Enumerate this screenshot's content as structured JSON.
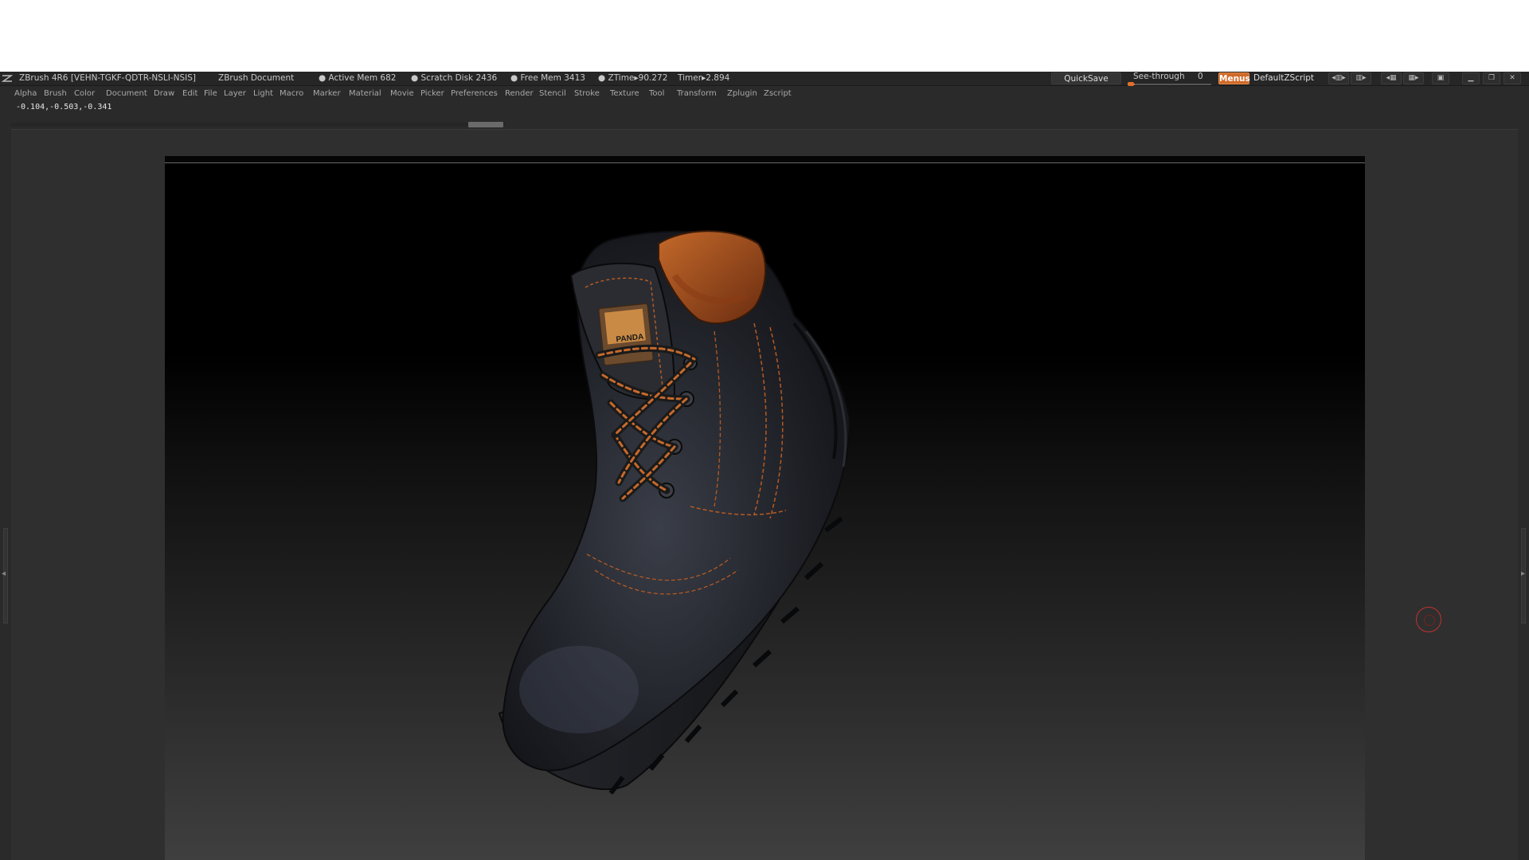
{
  "titlebar": {
    "app_title": "ZBrush 4R6 [VEHN-TGKF-QDTR-NSLI-NSIS]",
    "document_title": "ZBrush Document",
    "active_mem": "● Active Mem 682",
    "scratch_disk": "● Scratch Disk 2436",
    "free_mem": "● Free Mem 3413",
    "ztime": "● ZTime▸90.272",
    "timer": "Timer▸2.894",
    "quicksave": "QuickSave",
    "see_through_label": "See-through",
    "see_through_value": "0",
    "see_through_level": 0.09,
    "menus": "Menus",
    "default_zscript": "DefaultZScript"
  },
  "menu": {
    "items": [
      "Alpha",
      "Brush",
      "Color",
      "Document",
      "Draw",
      "Edit",
      "File",
      "Layer",
      "Light",
      "Macro",
      "Marker",
      "Material",
      "Movie",
      "Picker",
      "Preferences",
      "Render",
      "Stencil",
      "Stroke",
      "Texture",
      "Tool",
      "Transform",
      "Zplugin",
      "Zscript"
    ]
  },
  "status": {
    "coords": "-0.104,-0.503,-0.341"
  },
  "model": {
    "brand_label": "PANDA",
    "colors": {
      "leather": "#1d1f24",
      "stitch": "#c66a2c",
      "lining": "#b65a22",
      "accent": "#d06a2a"
    }
  }
}
